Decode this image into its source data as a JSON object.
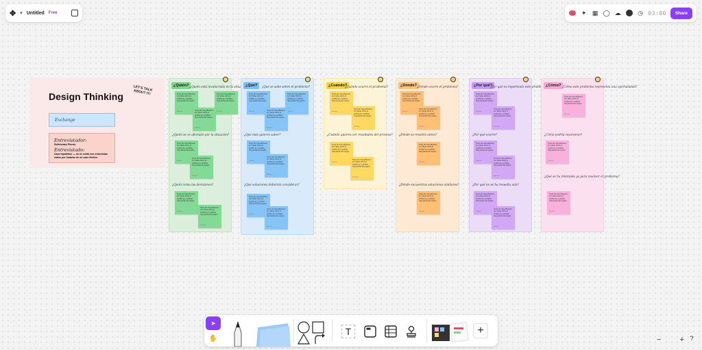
{
  "header": {
    "doc_title": "Untitled",
    "plan": "Free",
    "timer": "03:00",
    "share_label": "Share"
  },
  "board": {
    "title": "Design Thinking",
    "badge": "LET'S TALK ABOUT IT!",
    "exchange": "Exchange",
    "interview_label_1": "Entrevistador:",
    "interview_sub": "Solicionary Pincón",
    "interview_label_2": "Entrevistado:",
    "interview_text": "Caso hipotético — no se contó con entrevistas reales por instarse de un caso ficticio."
  },
  "columns": [
    {
      "tag": "¿Quién?",
      "questions": [
        "¿Quién está involucrado en la situación?",
        "¿Quién se ve afectado por la situación?",
        "¿Quién toma las decisiones?"
      ]
    },
    {
      "tag": "¿Qué?",
      "questions": [
        "¿Qué se sabe sobre el problema?",
        "¿Qué más quieres saber?",
        "¿Qué soluciones deberían considerar?"
      ]
    },
    {
      "tag": "¿Cuándo?",
      "questions": [
        "¿Cuándo ocurre el problema?",
        "¿Cuándo quieres ver resultados del proceso?"
      ]
    },
    {
      "tag": "¿Dónde?",
      "questions": [
        "¿Dónde ocurre el problema?",
        "¿Dónde se resolvió antes?",
        "¿Dónde encuentras soluciones similares?"
      ]
    },
    {
      "tag": "¿Por qué?",
      "questions": [
        "¿Por qué es importante este problema?",
        "¿Por qué ocurre?",
        "¿Por qué no se ha resuelto aún?"
      ]
    },
    {
      "tag": "¿Cómo?",
      "questions": [
        "¿Cómo este problema representa una oportunidad?",
        "¿Cómo podría resolverse?",
        "¿Qué se ha intentado ya para resolver el problema?"
      ]
    }
  ],
  "sticky_text": "Texto de nota adhesiva con ideas sobre el problema y posibles respuestas del equipo.",
  "sticky_author": "Miembro",
  "colors": {
    "accent": "#8a3ffc",
    "quien": {
      "bg": "#dcefdd",
      "tag": "#7fd48a",
      "sticky": "#83d996"
    },
    "que": {
      "bg": "#d9ebfb",
      "tag": "#7bbcf3",
      "sticky": "#86c4f7"
    },
    "cuando": {
      "bg": "#fdf3d6",
      "tag": "#f5d24c",
      "sticky": "#ffd95f"
    },
    "donde": {
      "bg": "#fde9d4",
      "tag": "#f8c07c",
      "sticky": "#ffbf75"
    },
    "porque": {
      "bg": "#ebdcf8",
      "tag": "#c79af2",
      "sticky": "#d2a8f6"
    },
    "como": {
      "bg": "#fbe0ef",
      "tag": "#f4a8d3",
      "sticky": "#f8b1dc"
    }
  },
  "toolbar": {
    "text_tool": "T",
    "add": "+",
    "zoom_out": "−",
    "zoom_in": "+",
    "help": "?"
  }
}
